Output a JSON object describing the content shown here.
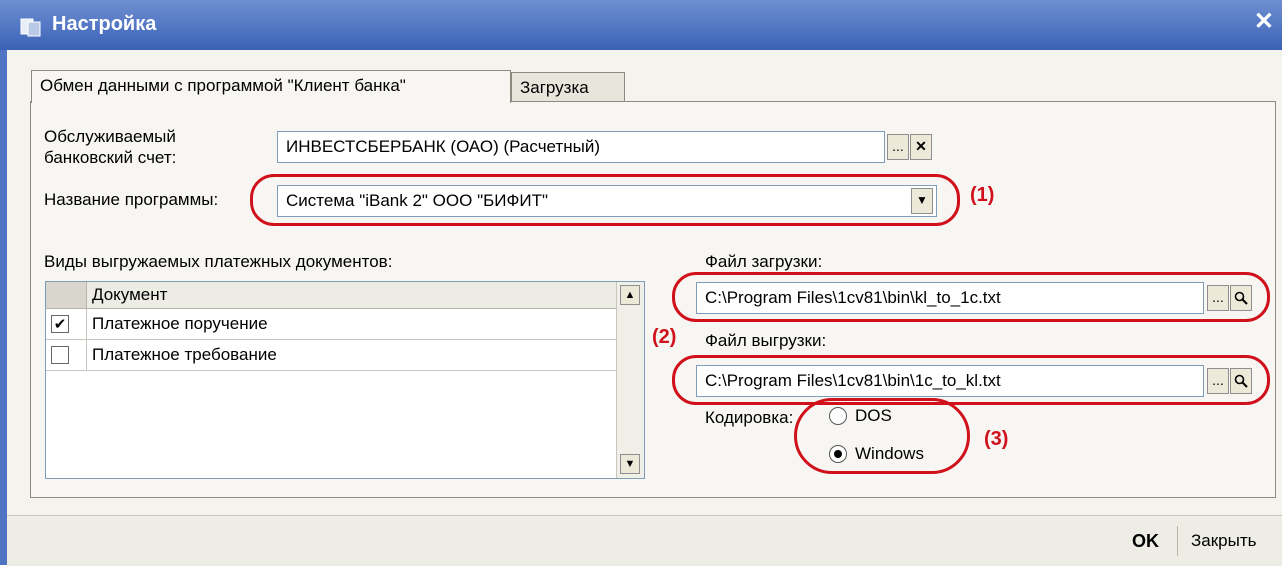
{
  "window": {
    "title": "Настройка",
    "close_glyph": "✕",
    "icon": "app-settings-icon"
  },
  "tabs": [
    {
      "label": "Обмен данными с программой \"Клиент банка\"",
      "active": true
    },
    {
      "label": "Загрузка",
      "active": false
    }
  ],
  "bank_account": {
    "label": "Обслуживаемый\nбанковский счет:",
    "value": "ИНВЕСТСБЕРБАНК (ОАО) (Расчетный)",
    "select_glyph": "...",
    "clear_glyph": "✕"
  },
  "program": {
    "label": "Название программы:",
    "value": "Система  \"iBank 2\" ООО \"БИФИТ\"",
    "dropdown_glyph": "▼"
  },
  "documents": {
    "label": "Виды выгружаемых платежных документов:",
    "column_header": "Документ",
    "rows": [
      {
        "name": "Платежное поручение",
        "checked": true,
        "mark": "✔"
      },
      {
        "name": "Платежное требование",
        "checked": false,
        "mark": ""
      }
    ],
    "scroll_up_glyph": "▲",
    "scroll_down_glyph": "▼"
  },
  "import_file": {
    "label": "Файл загрузки:",
    "value": "C:\\Program Files\\1cv81\\bin\\kl_to_1c.txt",
    "select_glyph": "...",
    "open_icon": "magnifier-icon"
  },
  "export_file": {
    "label": "Файл выгрузки:",
    "value": "C:\\Program Files\\1cv81\\bin\\1c_to_kl.txt",
    "select_glyph": "...",
    "open_icon": "magnifier-icon"
  },
  "encoding": {
    "label": "Кодировка:",
    "options": [
      {
        "label": "DOS",
        "selected": false
      },
      {
        "label": "Windows",
        "selected": true
      }
    ]
  },
  "annotations": [
    "(1)",
    "(2)",
    "(3)"
  ],
  "footer": {
    "ok_label": "OK",
    "close_label": "Закрыть"
  },
  "colors": {
    "title_bar": "#3a62b6",
    "annotation_red": "#d0101a",
    "dialog_bg": "#f4f3ee"
  }
}
